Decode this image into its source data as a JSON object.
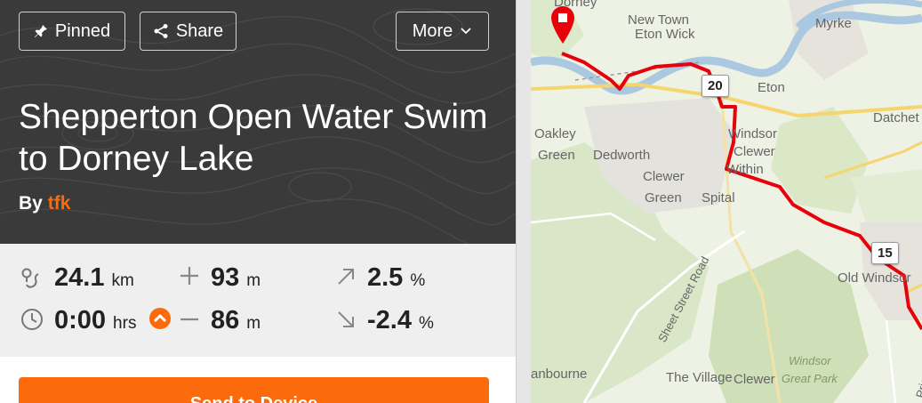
{
  "header": {
    "pinned_label": "Pinned",
    "share_label": "Share",
    "more_label": "More",
    "title": "Shepperton Open Water Swim to Dorney Lake",
    "by_label": "By",
    "author": "tfk"
  },
  "stats": {
    "distance": {
      "value": "24.1",
      "unit": "km"
    },
    "elevation_gain": {
      "value": "93",
      "unit": "m"
    },
    "max_grade": {
      "value": "2.5",
      "unit": "%"
    },
    "duration": {
      "value": "0:00",
      "unit": "hrs"
    },
    "elevation_loss": {
      "value": "86",
      "unit": "m"
    },
    "min_grade": {
      "value": "-2.4",
      "unit": "%"
    }
  },
  "cta": {
    "label": "Send to Device"
  },
  "map": {
    "labels": {
      "dorney": "Dorney",
      "new_town": "New Town",
      "eton_wick": "Eton Wick",
      "myrke": "Myrke",
      "eton": "Eton",
      "datchet": "Datchet",
      "oakley_green_1": "Oakley",
      "oakley_green_2": "Green",
      "dedworth": "Dedworth",
      "windsor": "Windsor",
      "clewer_within_1": "Clewer",
      "clewer_within_2": "Within",
      "clewer_green_1": "Clewer",
      "clewer_green_2": "Green",
      "spital": "Spital",
      "old_windsor": "Old Windsor",
      "sheet_street_road": "Sheet Street Road",
      "winkfield": "anbourne",
      "the_village": "The Village",
      "windsor_great_park_1": "Windsor",
      "windsor_great_park_2": "Great Park",
      "priest_hill": "Priest Hill",
      "clewer": "Clewer"
    },
    "markers": {
      "km20": "20",
      "km15": "15"
    },
    "route_color": "#e8000b"
  },
  "colors": {
    "accent": "#fc6b0b",
    "header_bg": "#3a3a3a"
  }
}
